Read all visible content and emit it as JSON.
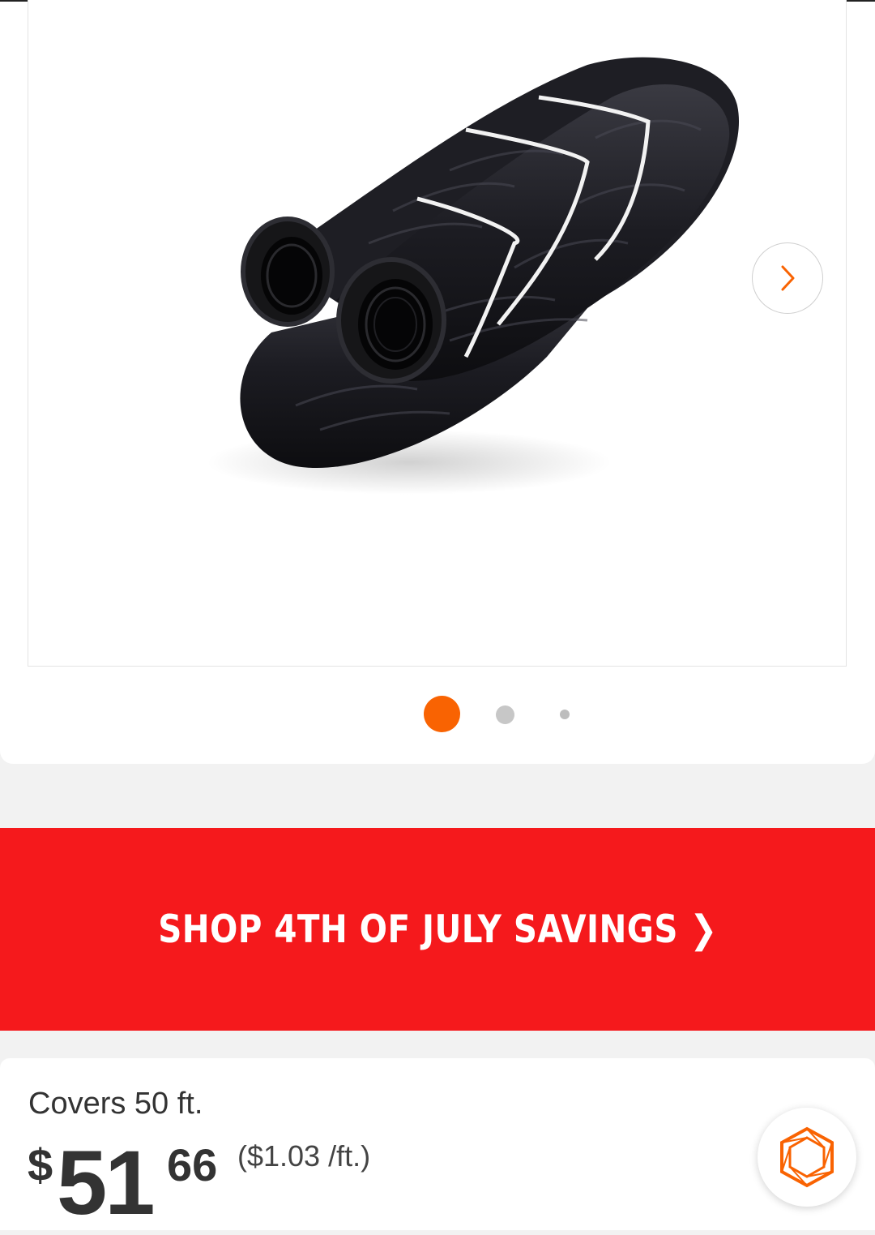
{
  "gallery": {
    "image_alt": "Black flexible corrugated drain pipe with filter sock, coiled and tied",
    "next_icon": "chevron-right-icon",
    "dots": 3,
    "active_dot": 0
  },
  "promo": {
    "text": "SHOP 4TH OF JULY SAVINGS ❯",
    "background": "#f5191c"
  },
  "pricing": {
    "coverage": "Covers 50 ft.",
    "currency": "$",
    "dollars": "51",
    "cents": "66",
    "unit_price": "($1.03 /ft.)"
  },
  "fab": {
    "icon": "hexagon-logo-icon",
    "accent": "#f96302"
  }
}
